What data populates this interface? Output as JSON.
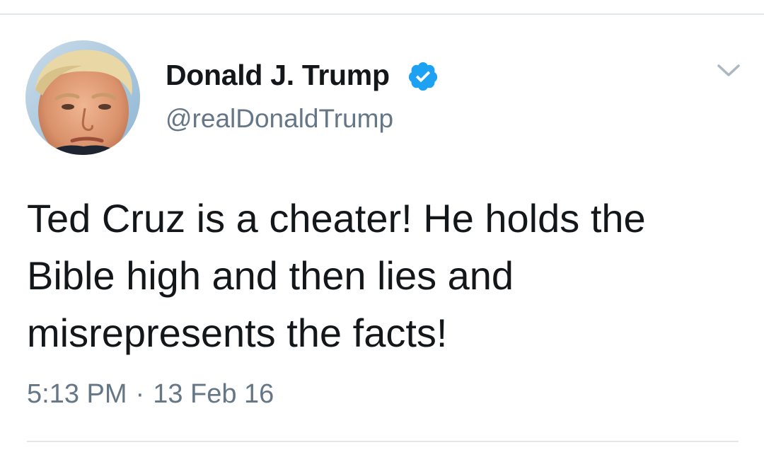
{
  "tweet": {
    "author": {
      "display_name": "Donald J. Trump",
      "handle": "@realDonaldTrump",
      "verified": true
    },
    "text": "Ted Cruz is a cheater! He holds the Bible high and then lies and misrepresents the facts!",
    "time": "5:13 PM",
    "separator": "·",
    "date": "13 Feb 16"
  },
  "icons": {
    "verified": "verified-badge-icon",
    "menu": "chevron-down-icon"
  },
  "colors": {
    "verified_blue": "#1da1f2",
    "text_primary": "#14171a",
    "text_secondary": "#657786",
    "divider": "#e1e8ed"
  }
}
